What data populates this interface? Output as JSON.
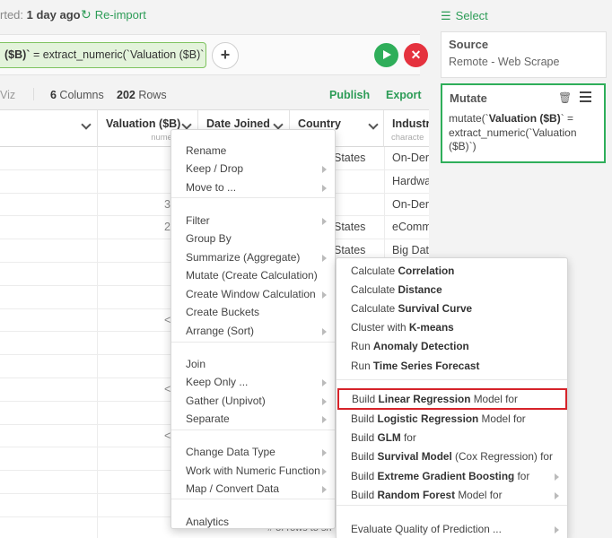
{
  "header": {
    "imported_prefix": "rted: ",
    "imported_when": "1 day ago",
    "reimport_label": "Re-import"
  },
  "formula": {
    "step_text_bold": "($B)`",
    "step_text_rest": " = extract_numeric(`Valuation ($B)`"
  },
  "info_bar": {
    "viz_label": "Viz",
    "column_count": "6",
    "columns_label": " Columns",
    "row_count": "202",
    "rows_label": " Rows",
    "publish_label": "Publish",
    "export_label": "Export"
  },
  "table": {
    "columns": [
      {
        "name": "Valuation ($B)",
        "type": "numeric"
      },
      {
        "name": "Date Joined",
        "type": ""
      },
      {
        "name": "Country",
        "type": ""
      },
      {
        "name": "Industr",
        "type": "characte"
      }
    ],
    "cells": {
      "country": [
        "States",
        "",
        "",
        "States",
        "States"
      ],
      "industry": [
        "On-Der",
        "Hardwa",
        "On-Der",
        "eComm",
        "Big Dat"
      ],
      "valuation_frag": [
        "",
        "",
        "3",
        "2",
        "",
        "",
        "",
        "<",
        "",
        "",
        "<",
        "",
        "<"
      ]
    },
    "footer_hint": "# of rows to sh"
  },
  "sidebar": {
    "select_label": "Select",
    "source": {
      "title": "Source",
      "subtitle": "Remote - Web Scrape"
    },
    "mutate": {
      "title": "Mutate",
      "code_prefix": "mutate(`",
      "code_bold": "Valuation ($B)",
      "code_suffix": "` = extract_numeric(`Valuation ($B)`)"
    }
  },
  "context_menu": {
    "items": [
      {
        "label": "Rename",
        "sub": false
      },
      {
        "label": "Keep / Drop",
        "sub": true
      },
      {
        "label": "Move to ...",
        "sub": true
      },
      {
        "label": "Filter",
        "sub": true
      },
      {
        "label": "Group By",
        "sub": false
      },
      {
        "label": "Summarize (Aggregate)",
        "sub": true
      },
      {
        "label": "Mutate (Create Calculation)",
        "sub": false
      },
      {
        "label": "Create Window Calculation",
        "sub": true
      },
      {
        "label": "Create Buckets",
        "sub": false
      },
      {
        "label": "Arrange (Sort)",
        "sub": true
      },
      {
        "label": "Join",
        "sub": false
      },
      {
        "label": "Keep Only ...",
        "sub": true
      },
      {
        "label": "Gather (Unpivot)",
        "sub": true
      },
      {
        "label": "Separate",
        "sub": true
      },
      {
        "label": "Change Data Type",
        "sub": true
      },
      {
        "label": "Work with Numeric Function",
        "sub": true
      },
      {
        "label": "Map / Convert Data",
        "sub": true
      },
      {
        "label": "Analytics",
        "sub": false
      }
    ]
  },
  "analytics_submenu": {
    "items": [
      {
        "pre": "Calculate ",
        "bold": "Correlation",
        "post": ""
      },
      {
        "pre": "Calculate ",
        "bold": "Distance",
        "post": ""
      },
      {
        "pre": "Calculate ",
        "bold": "Survival Curve",
        "post": ""
      },
      {
        "pre": "Cluster with ",
        "bold": "K-means",
        "post": ""
      },
      {
        "pre": "Run ",
        "bold": "Anomaly Detection",
        "post": ""
      },
      {
        "pre": "Run ",
        "bold": "Time Series Forecast",
        "post": ""
      },
      {
        "pre": "Build ",
        "bold": "Linear Regression",
        "post": " Model for"
      },
      {
        "pre": "Build ",
        "bold": "Logistic Regression",
        "post": " Model for"
      },
      {
        "pre": "Build ",
        "bold": "GLM",
        "post": " for"
      },
      {
        "pre": "Build ",
        "bold": "Survival Model",
        "post": " (Cox Regression) for"
      },
      {
        "pre": "Build ",
        "bold": "Extreme Gradient Boosting",
        "post": " for"
      },
      {
        "pre": "Build ",
        "bold": "Random Forest",
        "post": " Model for"
      },
      {
        "pre": "Evaluate Quality of Prediction ...",
        "bold": "",
        "post": ""
      }
    ],
    "highlighted_index": 6
  },
  "colors": {
    "accent": "#2d9c57",
    "highlight_border": "#d6232a",
    "danger": "#e5323e"
  }
}
